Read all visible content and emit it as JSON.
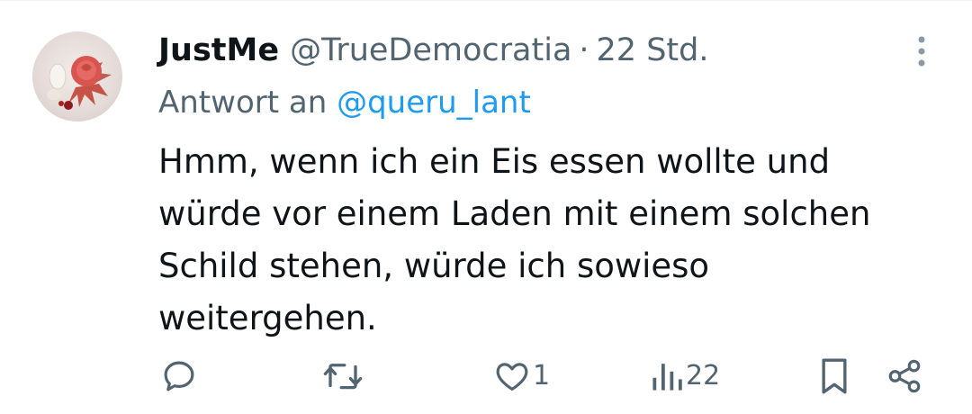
{
  "tweet": {
    "display_name": "JustMe",
    "handle": "@TrueDemocratia",
    "separator": "·",
    "time": "22 Std.",
    "reply_prefix": "Antwort an",
    "reply_mention": "@queru_lant",
    "body_lines": [
      "Hmm, wenn ich ein Eis essen wollte und",
      "würde vor einem Laden mit einem solchen",
      "Schild stehen, würde ich sowieso",
      "weitergehen."
    ]
  },
  "actions": {
    "reply": {
      "icon": "reply-icon"
    },
    "retweet": {
      "icon": "retweet-icon"
    },
    "like": {
      "icon": "heart-icon",
      "count": "1"
    },
    "views": {
      "icon": "views-icon",
      "count": "22"
    },
    "bookmark": {
      "icon": "bookmark-icon"
    },
    "share": {
      "icon": "share-icon"
    }
  },
  "colors": {
    "text": "#0f1419",
    "muted": "#536471",
    "link": "#1d9bf0",
    "background": "#ffffff"
  }
}
